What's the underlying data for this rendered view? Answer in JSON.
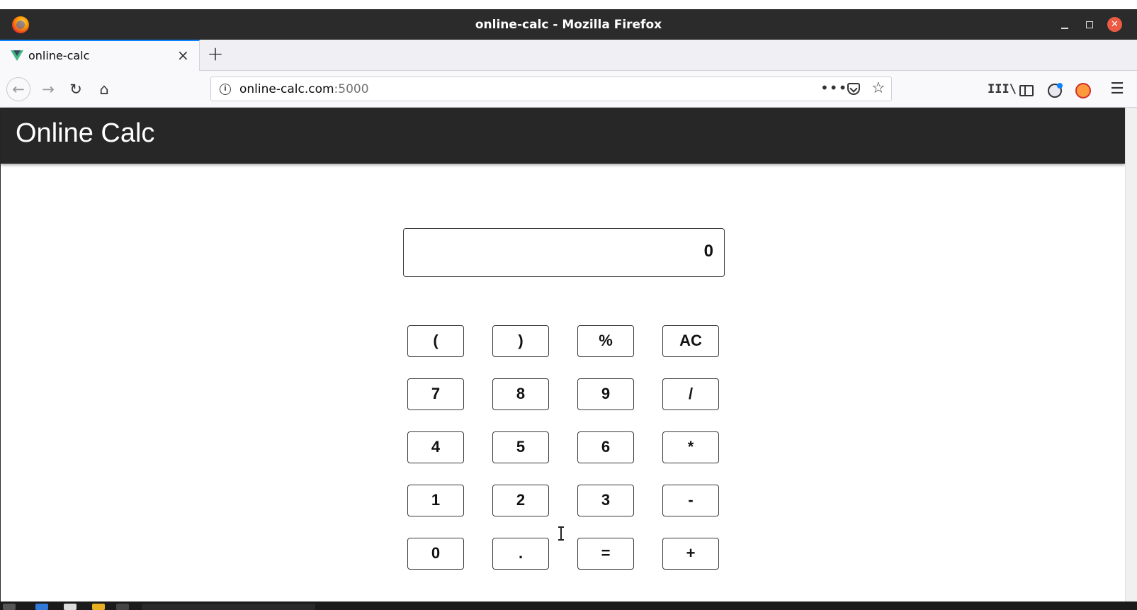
{
  "window": {
    "title": "online-calc - Mozilla Firefox"
  },
  "tab": {
    "label": "online-calc",
    "close_glyph": "×"
  },
  "newtab_glyph": "+",
  "nav": {
    "back_glyph": "←",
    "forward_glyph": "→",
    "reload_glyph": "↻",
    "home_glyph": "⌂"
  },
  "url": {
    "host": "online-calc.com",
    "port": ":5000",
    "more_glyph": "•••",
    "star_glyph": "☆"
  },
  "toolbar": {
    "library_glyph": "III\\",
    "menu_glyph": "☰"
  },
  "app": {
    "title": "Online Calc"
  },
  "calculator": {
    "display_value": "0",
    "keys": [
      [
        "(",
        ")",
        "%",
        "AC"
      ],
      [
        "7",
        "8",
        "9",
        "/"
      ],
      [
        "4",
        "5",
        "6",
        "*"
      ],
      [
        "1",
        "2",
        "3",
        "-"
      ],
      [
        "0",
        ".",
        "=",
        "+"
      ]
    ]
  },
  "colors": {
    "appbar": "#272727",
    "titlebar": "#2b2b2b",
    "tab_accent": "#0a84ff",
    "vue_green": "#41b883"
  }
}
